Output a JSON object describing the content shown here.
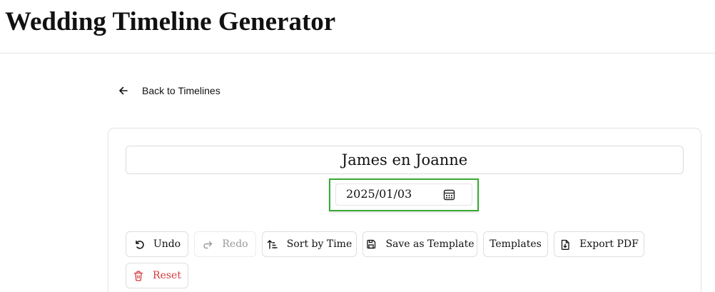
{
  "app": {
    "title": "Wedding Timeline Generator"
  },
  "nav": {
    "back_label": "Back to Timelines"
  },
  "timeline": {
    "name": "James en Joanne",
    "date": "2025/01/03"
  },
  "toolbar": {
    "undo": "Undo",
    "redo": "Redo",
    "sort": "Sort by Time",
    "save_template": "Save as Template",
    "templates": "Templates",
    "export_pdf": "Export PDF",
    "reset": "Reset"
  },
  "colors": {
    "focus_outline": "#3aaa35",
    "danger": "#d23b3b",
    "disabled_text": "#9a9a9a"
  },
  "icons": {
    "back": "arrow-left-icon",
    "calendar": "calendar-icon",
    "undo": "undo-icon",
    "redo": "redo-icon",
    "sort": "sort-ascending-icon",
    "save": "save-icon",
    "export": "file-download-icon",
    "reset": "trash-icon"
  }
}
